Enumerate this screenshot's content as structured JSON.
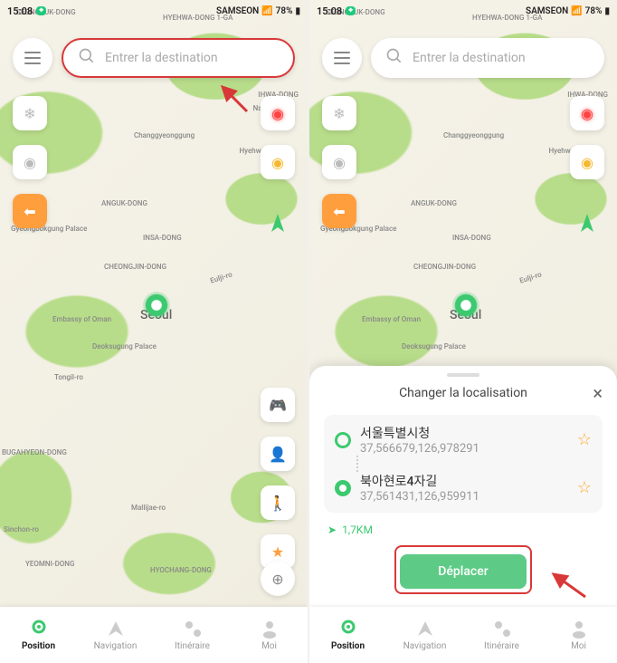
{
  "status": {
    "time": "15:08",
    "carrier": "SAMSEON",
    "signal": "▮▮▮▮",
    "battery": "78%"
  },
  "search": {
    "placeholder": "Entrer la destination"
  },
  "map_labels": {
    "l1": "SEONGBUK-DONG",
    "l2": "HYEHWA-DONG 1-GA",
    "l3": "IHWA-DONG",
    "l4": "Changgyeonggung",
    "l5": "Hyehwa Wa Dae",
    "l6": "ANGUK-DONG",
    "l7": "Gyeongbokgung Palace",
    "l8": "INSA-DONG",
    "l9": "CHEONGJIN-DONG",
    "l10": "Embassy of Oman",
    "l11": "Seoul",
    "l12": "Deoksugung Palace",
    "l13": "Tongil-ro",
    "l14": "BUGAHYEON-DONG",
    "l15": "Sinchon-ro",
    "l16": "Mallijae-ro",
    "l17": "YEOMNI-DONG",
    "l18": "HYOCHANG-DONG",
    "l19": "Eulji-ro",
    "l20": "Naksan Park"
  },
  "nav": {
    "position": "Position",
    "navigation": "Navigation",
    "itineraire": "Itinéraire",
    "moi": "Moi"
  },
  "sheet": {
    "title": "Changer la localisation",
    "start": {
      "name": "서울특별시청",
      "coords": "37,566679,126,978291"
    },
    "end": {
      "name": "북아현로4자길",
      "coords": "37,561431,126,959911"
    },
    "distance": "1,7KM",
    "button": "Déplacer"
  }
}
